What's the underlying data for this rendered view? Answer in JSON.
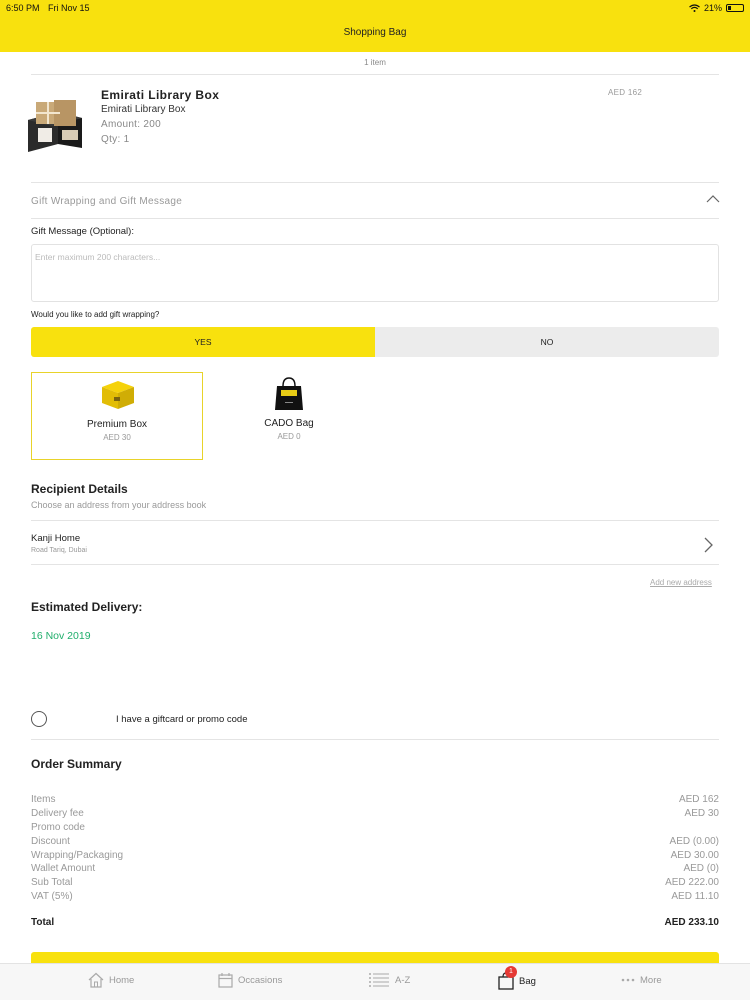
{
  "status_bar": {
    "time": "6:50 PM",
    "date": "Fri Nov 15",
    "battery": "21%"
  },
  "header": {
    "title": "Shopping Bag"
  },
  "cart": {
    "item_count": "1 item",
    "product": {
      "name": "Emirati Library Box",
      "subtitle": "Emirati Library Box",
      "amount": "Amount: 200",
      "qty": "Qty: 1",
      "price": "AED 162"
    }
  },
  "gift": {
    "section_title": "Gift Wrapping and Gift Message",
    "message_label": "Gift Message (Optional):",
    "message_placeholder": "Enter maximum 200 characters...",
    "message_value": "",
    "wrap_question": "Would you like to add gift wrapping?",
    "yes_label": "YES",
    "no_label": "NO",
    "selected": "YES",
    "options": [
      {
        "name": "Premium Box",
        "price": "AED 30",
        "icon": "yellow-gift-box-icon",
        "selected": true
      },
      {
        "name": "CADO Bag",
        "price": "AED 0",
        "icon": "black-shopping-bag-icon",
        "selected": false
      }
    ]
  },
  "recipient": {
    "title": "Recipient Details",
    "subtitle": "Choose an address from your address book",
    "address_name": "Kanji Home",
    "address_line": "Road Tariq, Dubai",
    "add_new": "Add new address"
  },
  "delivery": {
    "title": "Estimated Delivery:",
    "date": "16 Nov 2019",
    "date_color": "#1fae6b"
  },
  "promo": {
    "label": "I have a giftcard or promo code"
  },
  "order_summary": {
    "title": "Order Summary",
    "rows": [
      {
        "label": "Items",
        "value": "AED 162"
      },
      {
        "label": "Delivery fee",
        "value": "AED 30"
      },
      {
        "label": "Promo code",
        "value": ""
      },
      {
        "label": "Discount",
        "value": "AED (0.00)"
      },
      {
        "label": "Wrapping/Packaging",
        "value": "AED 30.00"
      },
      {
        "label": "Wallet Amount",
        "value": "AED (0)"
      },
      {
        "label": "Sub Total",
        "value": "AED 222.00"
      },
      {
        "label": "VAT (5%)",
        "value": "AED 11.10"
      }
    ],
    "total_label": "Total",
    "total_value": "AED 233.10"
  },
  "tab_bar": {
    "tabs": [
      {
        "label": "Home",
        "icon": "home-icon"
      },
      {
        "label": "Occasions",
        "icon": "calendar-icon"
      },
      {
        "label": "A-Z",
        "icon": "list-icon"
      },
      {
        "label": "Bag",
        "icon": "bag-icon",
        "active": true
      },
      {
        "label": "More",
        "icon": "more-dots-icon"
      }
    ],
    "bag_badge": "1"
  },
  "colors": {
    "brand_yellow": "#f8e10e",
    "delivery_green": "#1fae6b",
    "badge_red": "#e53935"
  }
}
